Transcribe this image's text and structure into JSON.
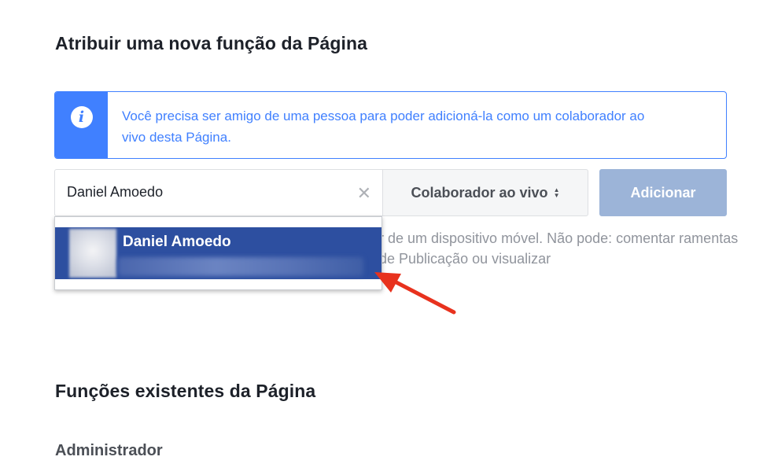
{
  "assign_section": {
    "title": "Atribuir uma nova função da Página"
  },
  "notice": {
    "icon": "info-icon",
    "icon_glyph": "i",
    "text": "Você precisa ser amigo de uma pessoa para poder adicioná-la como um colaborador ao vivo desta Página."
  },
  "search": {
    "value": "Daniel Amoedo",
    "clear_glyph": "✕"
  },
  "role_select": {
    "selected": "Colaborador ao vivo"
  },
  "add_button": {
    "label": "Adicionar"
  },
  "role_description": {
    "text": "r de um dispositivo móvel. Não pode: comentar ramentas de Publicação ou visualizar"
  },
  "suggestions": [
    {
      "name": "Daniel Amoedo"
    }
  ],
  "existing_section": {
    "title": "Funções existentes da Página",
    "first_group": "Administrador"
  },
  "colors": {
    "accent": "#4080ff",
    "selection": "#2d4fa0",
    "disabled_button": "#9cb4d8",
    "annotation_arrow": "#e8321e"
  }
}
